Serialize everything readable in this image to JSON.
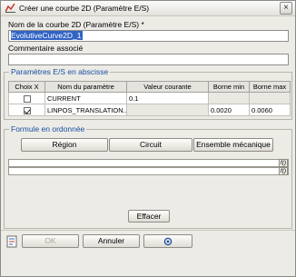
{
  "window": {
    "title": "Créer une courbe 2D (Paramètre E/S)",
    "close_symbol": "×"
  },
  "name_section": {
    "label": "Nom de la courbe 2D (Paramètre E/S) *",
    "value": "EvolutiveCurve2D_1"
  },
  "comment_section": {
    "label": "Commentaire associé",
    "value": ""
  },
  "params_group": {
    "title": "Paramètres E/S en abscisse",
    "columns": [
      "Choix X",
      "Nom du paramètre",
      "Valeur courante",
      "Borne min",
      "Borne max"
    ],
    "rows": [
      {
        "checked": false,
        "name": "CURRENT",
        "value": "0.1",
        "min": "",
        "max": ""
      },
      {
        "checked": true,
        "name": "LINPOS_TRANSLATION...",
        "value": "",
        "min": "0.0020",
        "max": "0.0060"
      }
    ]
  },
  "formula_group": {
    "title": "Formule en ordonnée",
    "buttons": {
      "region": "Région",
      "circuit": "Circuit",
      "ensemble": "Ensemble mécanique"
    },
    "fx_label": "f()",
    "clear_button": "Effacer"
  },
  "footer": {
    "ok": "OK",
    "cancel": "Annuler",
    "third_icon": "circle-icon"
  },
  "colors": {
    "selection": "#3163c5",
    "group_title": "#1a4fa0",
    "background": "#ecebe6"
  }
}
